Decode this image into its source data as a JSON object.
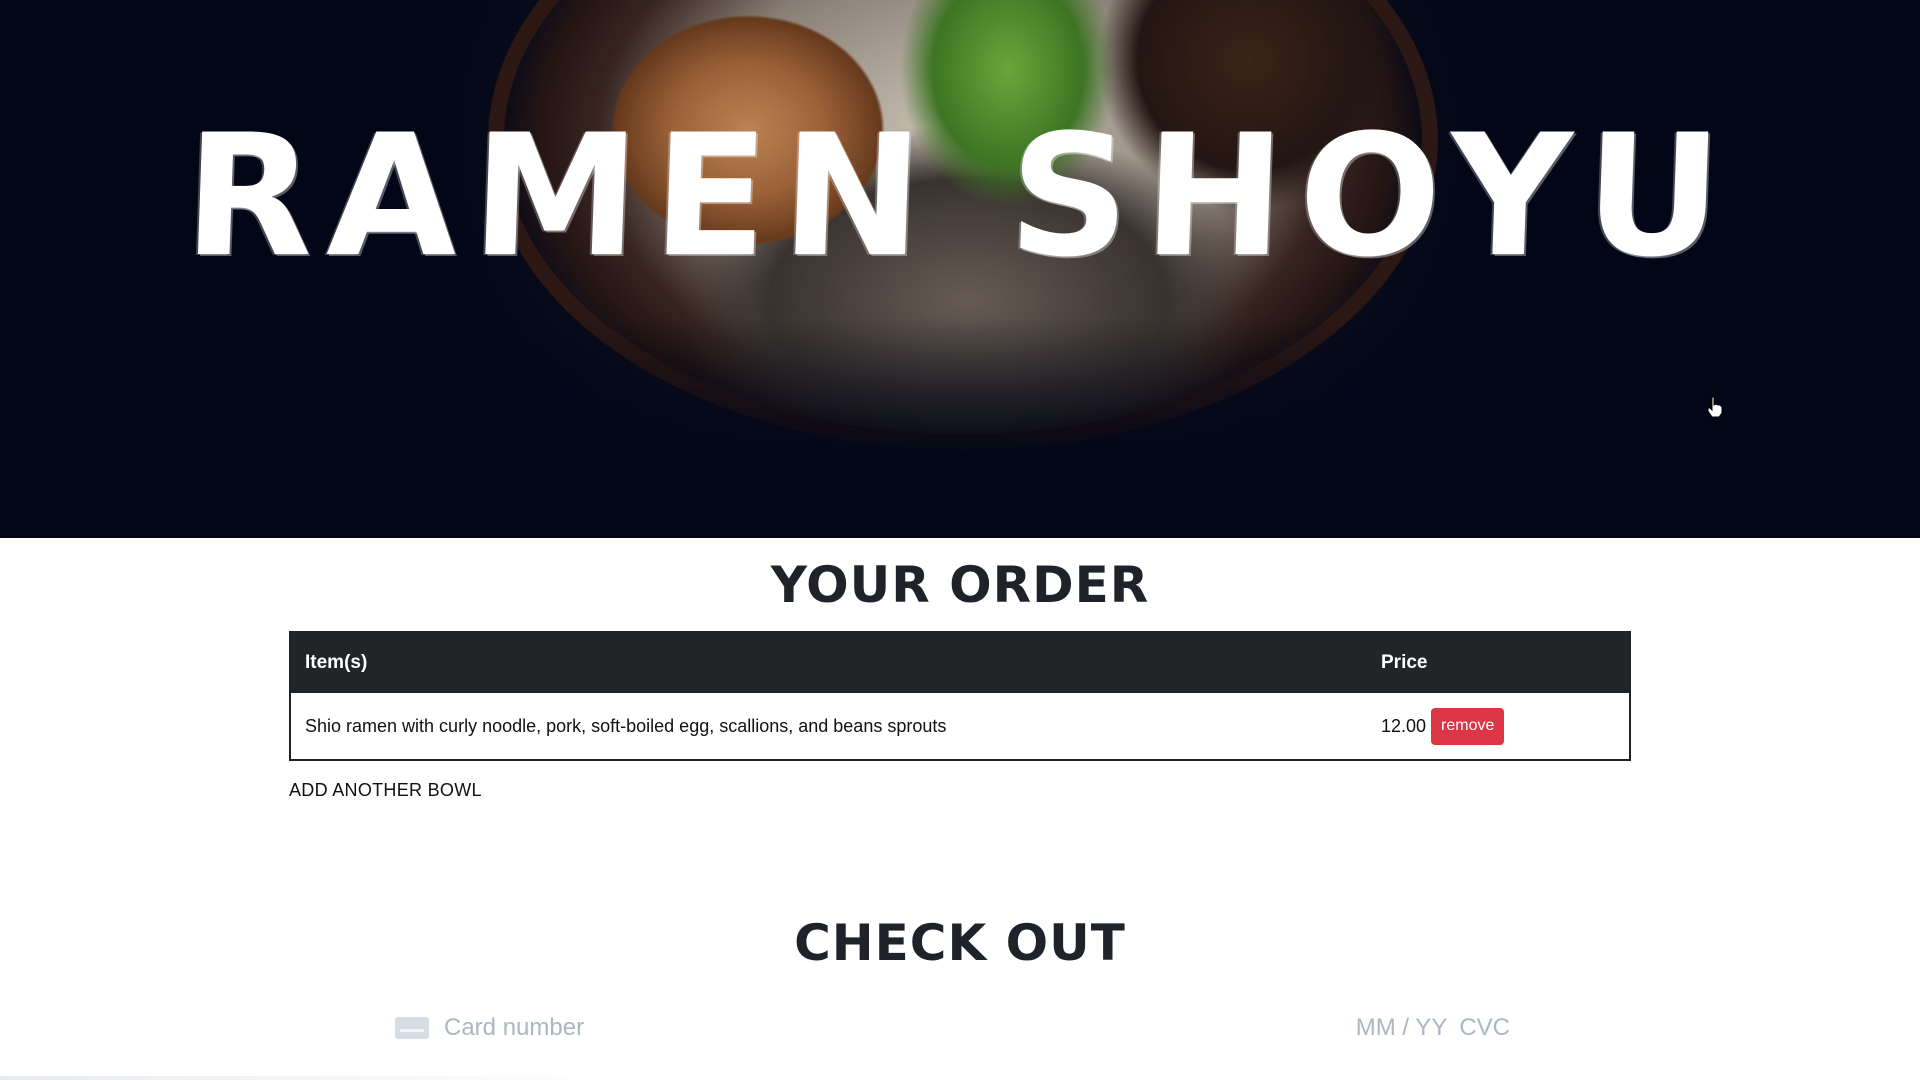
{
  "hero": {
    "title": "RAMEN SHOYU"
  },
  "order": {
    "title": "YOUR ORDER",
    "columns": [
      "Item(s)",
      "Price"
    ],
    "rows": [
      {
        "item": "Shio ramen with curly noodle, pork, soft-boiled egg, scallions, and beans sprouts",
        "price": "12.00",
        "action": "remove"
      }
    ],
    "add_link": "ADD ANOTHER BOWL"
  },
  "checkout": {
    "title": "CHECK OUT",
    "card_number_placeholder": "Card number",
    "expiry_placeholder": "MM / YY",
    "cvc_placeholder": "CVC",
    "card_icon": "credit-card-icon"
  },
  "colors": {
    "hero_bg": "#020617",
    "table_header_bg": "#222528",
    "remove_button": "#dc3545",
    "placeholder_text": "#aab7c4"
  }
}
